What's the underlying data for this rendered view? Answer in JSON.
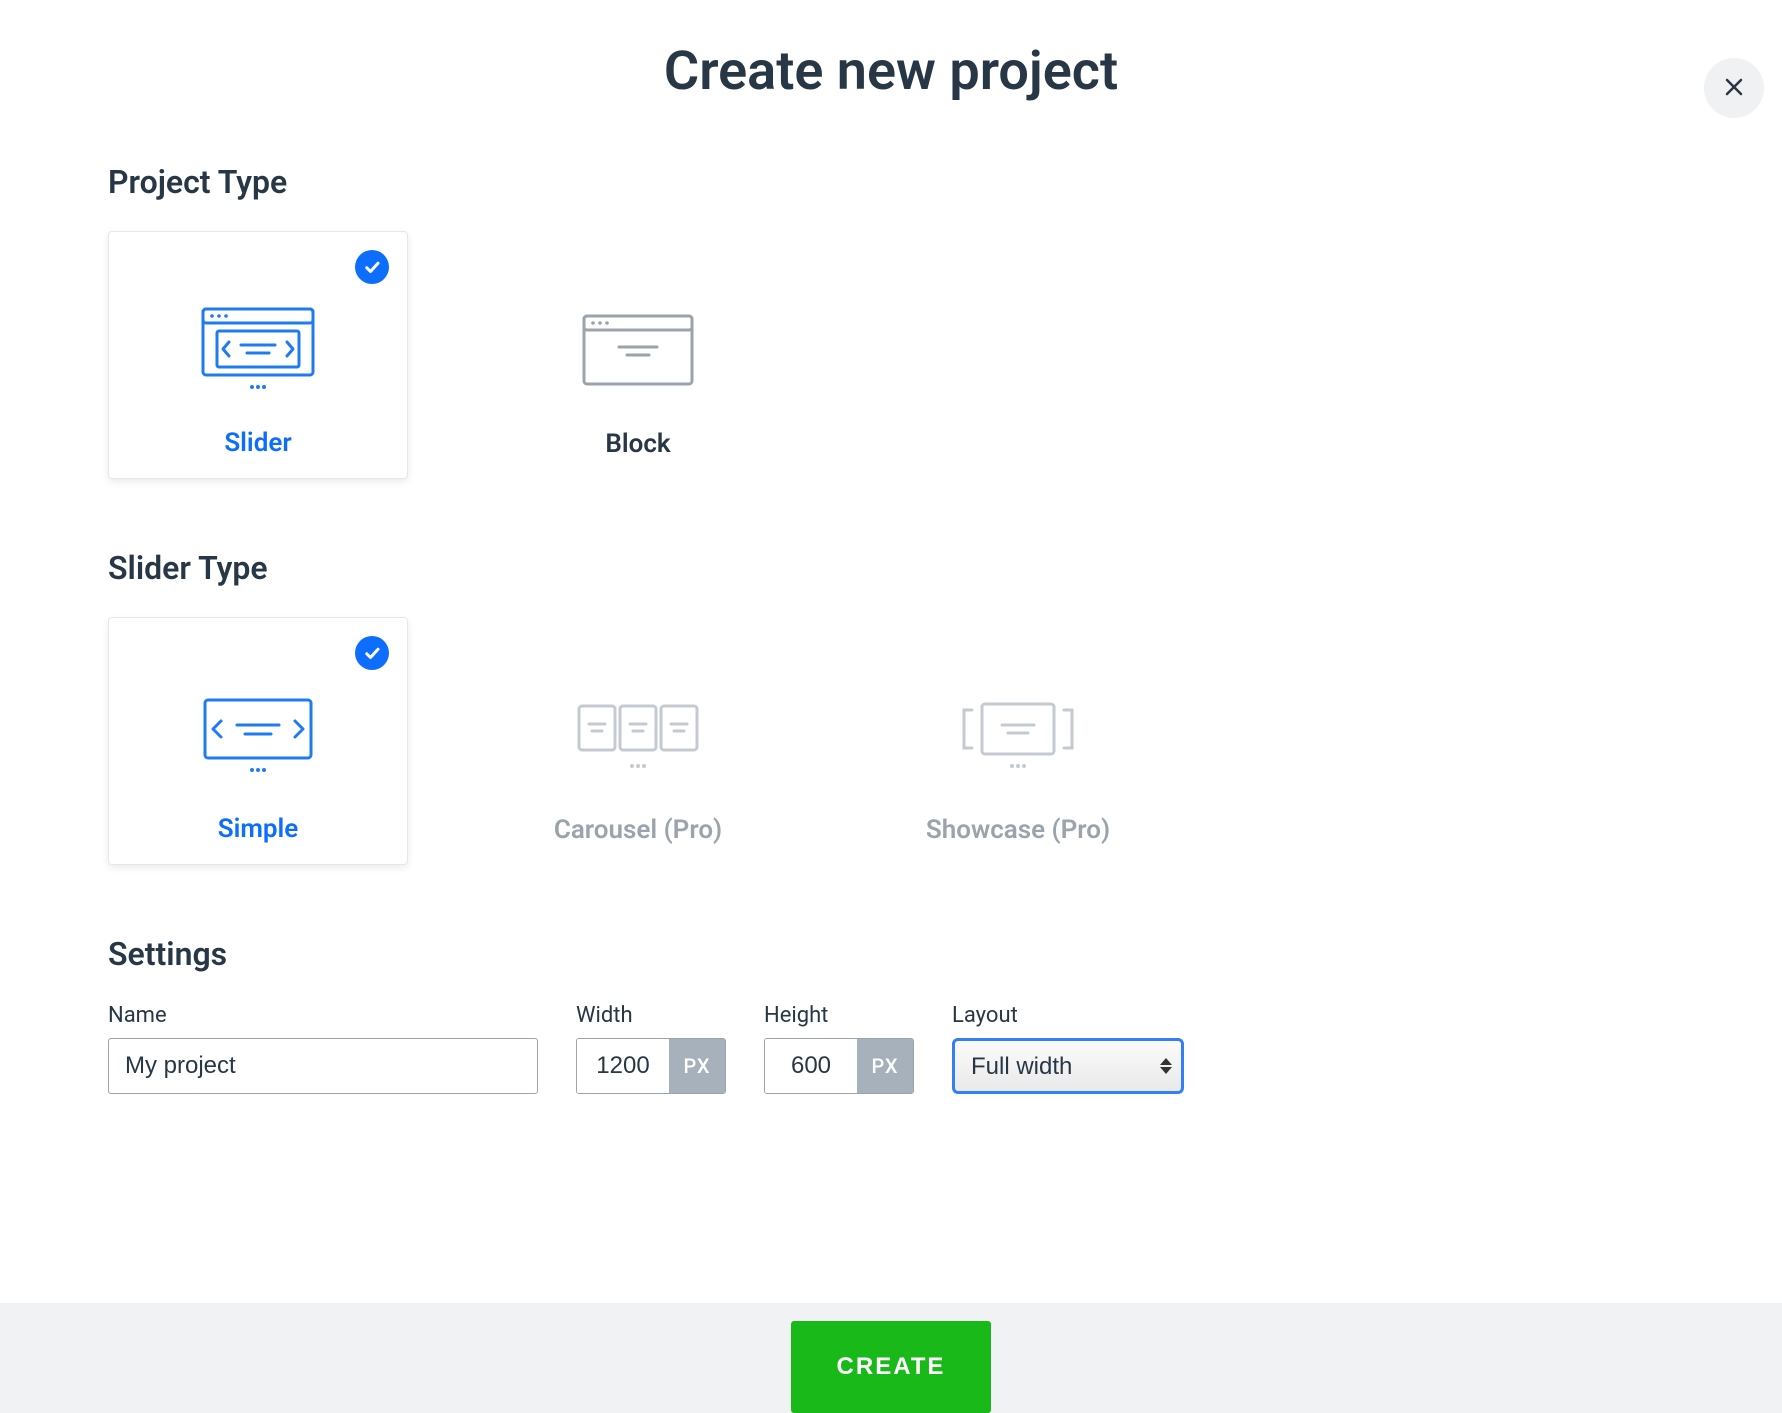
{
  "modal": {
    "title": "Create new project",
    "create_button": "CREATE"
  },
  "sections": {
    "project_type": "Project Type",
    "slider_type": "Slider Type",
    "settings": "Settings"
  },
  "project_types": [
    {
      "label": "Slider",
      "selected": true
    },
    {
      "label": "Block",
      "selected": false
    }
  ],
  "slider_types": [
    {
      "label": "Simple",
      "selected": true,
      "disabled": false
    },
    {
      "label": "Carousel (Pro)",
      "selected": false,
      "disabled": true
    },
    {
      "label": "Showcase (Pro)",
      "selected": false,
      "disabled": true
    }
  ],
  "settings": {
    "name_label": "Name",
    "name_value": "My project",
    "width_label": "Width",
    "width_value": "1200",
    "width_unit": "PX",
    "height_label": "Height",
    "height_value": "600",
    "height_unit": "PX",
    "layout_label": "Layout",
    "layout_value": "Full width"
  }
}
